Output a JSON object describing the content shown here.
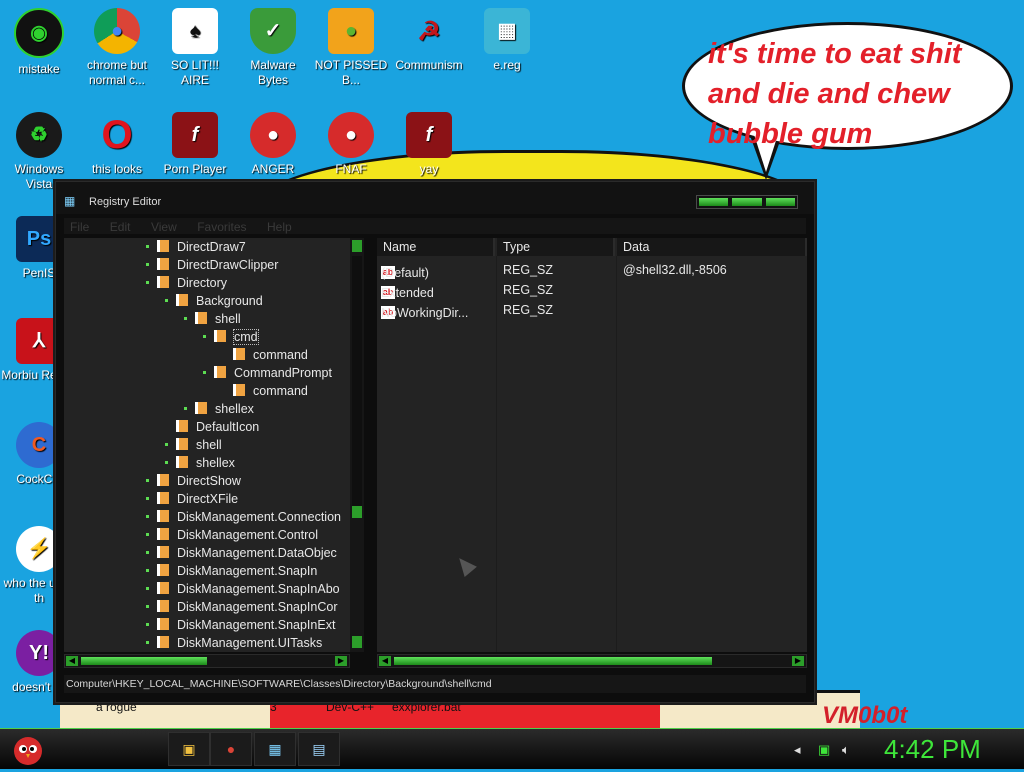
{
  "bubble": {
    "text": "it's time to eat shit and die and chew bubble gum"
  },
  "wallpaper": {
    "bottom_labels": [
      "a rogue",
      "3",
      "Dev-C++",
      "exxplorer.bat"
    ],
    "signature": "VM0b0t"
  },
  "desktop": {
    "icons": [
      {
        "label": "mistake",
        "icon": "razer-icon"
      },
      {
        "label": "chrome but normal c...",
        "icon": "chrome-icon"
      },
      {
        "label": "SO LIT!!! AIRE",
        "icon": "solitaire-icon"
      },
      {
        "label": "Malware Bytes",
        "icon": "shield-check-icon"
      },
      {
        "label": "NOT PISSED B...",
        "icon": "angry-pig-icon"
      },
      {
        "label": "Communism",
        "icon": "hammer-sickle-icon"
      },
      {
        "label": "e.reg",
        "icon": "registry-icon"
      },
      {
        "label": "Windows Vista",
        "icon": "recycle-bin-icon"
      },
      {
        "label": "this looks",
        "icon": "opera-icon"
      },
      {
        "label": "Porn Player",
        "icon": "flash-icon"
      },
      {
        "label": "ANGER",
        "icon": "angry-bird-icon"
      },
      {
        "label": "FNAF",
        "icon": "angry-bird-icon"
      },
      {
        "label": "yay",
        "icon": "flash-icon"
      },
      {
        "label": "PenIS",
        "icon": "photoshop-icon"
      },
      {
        "label": "Morbiu Reade",
        "icon": "acrobat-icon"
      },
      {
        "label": "CockCle",
        "icon": "ccleaner-icon"
      },
      {
        "label": "who the uses th",
        "icon": "avast-icon"
      },
      {
        "label": "doesn't lol",
        "icon": "yahoo-icon"
      }
    ]
  },
  "regedit": {
    "title": "Registry Editor",
    "menu": [
      "File",
      "Edit",
      "View",
      "Favorites",
      "Help"
    ],
    "tree": [
      "DirectDraw7",
      "DirectDrawClipper",
      "Directory",
      "Background",
      "shell",
      "cmd",
      "command",
      "CommandPrompt",
      "command",
      "shellex",
      "DefaultIcon",
      "shell",
      "shellex",
      "DirectShow",
      "DirectXFile",
      "DiskManagement.Connection",
      "DiskManagement.Control",
      "DiskManagement.DataObjec",
      "DiskManagement.SnapIn",
      "DiskManagement.SnapInAbo",
      "DiskManagement.SnapInCor",
      "DiskManagement.SnapInExt",
      "DiskManagement.UITasks"
    ],
    "columns": [
      "Name",
      "Type",
      "Data"
    ],
    "values": [
      {
        "name": "(Default)",
        "type": "REG_SZ",
        "data": "@shell32.dll,-8506"
      },
      {
        "name": "Extended",
        "type": "REG_SZ",
        "data": ""
      },
      {
        "name": "NoWorkingDir...",
        "type": "REG_SZ",
        "data": ""
      }
    ],
    "status_path": "Computer\\HKEY_LOCAL_MACHINE\\SOFTWARE\\Classes\\Directory\\Background\\shell\\cmd"
  },
  "taskbar": {
    "clock": "4:42 PM",
    "buttons": [
      "folder-icon",
      "chrome-icon",
      "registry-icon",
      "notepad-icon"
    ],
    "tray": [
      "chevron-icon",
      "network-icon",
      "volume-icon"
    ]
  },
  "colors": {
    "accent": "#3ee63a",
    "desktop_bg": "#1aa3e0",
    "bubble_text": "#e3202a"
  }
}
